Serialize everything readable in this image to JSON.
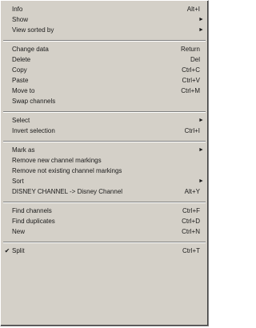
{
  "menu": {
    "items": [
      {
        "label": "Info",
        "shortcut": "Alt+I",
        "submenu": false,
        "checked": false
      },
      {
        "label": "Show",
        "shortcut": "",
        "submenu": true,
        "checked": false
      },
      {
        "label": "View sorted by",
        "shortcut": "",
        "submenu": true,
        "checked": false
      },
      {
        "label": "Change data",
        "shortcut": "Return",
        "submenu": false,
        "checked": false
      },
      {
        "label": "Delete",
        "shortcut": "Del",
        "submenu": false,
        "checked": false
      },
      {
        "label": "Copy",
        "shortcut": "Ctrl+C",
        "submenu": false,
        "checked": false
      },
      {
        "label": "Paste",
        "shortcut": "Ctrl+V",
        "submenu": false,
        "checked": false
      },
      {
        "label": "Move to",
        "shortcut": "Ctrl+M",
        "submenu": false,
        "checked": false
      },
      {
        "label": "Swap channels",
        "shortcut": "",
        "submenu": false,
        "checked": false
      },
      {
        "label": "Select",
        "shortcut": "",
        "submenu": true,
        "checked": false
      },
      {
        "label": "Invert selection",
        "shortcut": "Ctrl+I",
        "submenu": false,
        "checked": false
      },
      {
        "label": "Mark as",
        "shortcut": "",
        "submenu": true,
        "checked": false
      },
      {
        "label": "Remove new channel markings",
        "shortcut": "",
        "submenu": false,
        "checked": false
      },
      {
        "label": "Remove not existing channel markings",
        "shortcut": "",
        "submenu": false,
        "checked": false
      },
      {
        "label": "Sort",
        "shortcut": "",
        "submenu": true,
        "checked": false
      },
      {
        "label": "DISNEY CHANNEL -> Disney Channel",
        "shortcut": "Alt+Y",
        "submenu": false,
        "checked": false
      },
      {
        "label": "Find channels",
        "shortcut": "Ctrl+F",
        "submenu": false,
        "checked": false
      },
      {
        "label": "Find duplicates",
        "shortcut": "Ctrl+D",
        "submenu": false,
        "checked": false
      },
      {
        "label": "New",
        "shortcut": "Ctrl+N",
        "submenu": false,
        "checked": false
      },
      {
        "label": "Split",
        "shortcut": "Ctrl+T",
        "submenu": false,
        "checked": true
      }
    ],
    "check_glyph": "✔",
    "arrow_glyph": "►"
  }
}
